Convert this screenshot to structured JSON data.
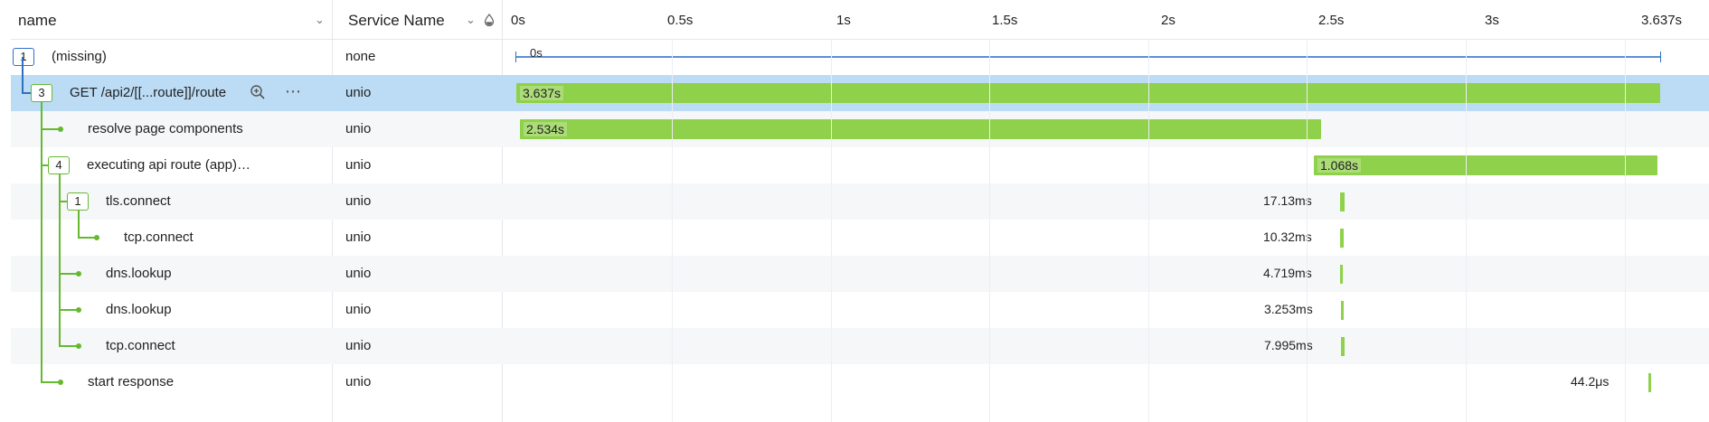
{
  "header": {
    "name_col": "name",
    "service_col": "Service Name",
    "ticks": [
      "0s",
      "0.5s",
      "1s",
      "1.5s",
      "2s",
      "2.5s",
      "3s",
      "3.637s"
    ]
  },
  "rows": [
    {
      "badge": "1",
      "name": "(missing)",
      "service": "none",
      "bar_label": "0s"
    },
    {
      "badge": "3",
      "name": "GET /api2/[[...route]]/route",
      "service": "unio",
      "bar_label": "3.637s"
    },
    {
      "name": "resolve page components",
      "service": "unio",
      "bar_label": "2.534s"
    },
    {
      "badge": "4",
      "name": "executing api route (app)…",
      "service": "unio",
      "bar_label": "1.068s"
    },
    {
      "badge": "1",
      "name": "tls.connect",
      "service": "unio",
      "bar_label": "17.13ms"
    },
    {
      "name": "tcp.connect",
      "service": "unio",
      "bar_label": "10.32ms"
    },
    {
      "name": "dns.lookup",
      "service": "unio",
      "bar_label": "4.719ms"
    },
    {
      "name": "dns.lookup",
      "service": "unio",
      "bar_label": "3.253ms"
    },
    {
      "name": "tcp.connect",
      "service": "unio",
      "bar_label": "7.995ms"
    },
    {
      "name": "start response",
      "service": "unio",
      "bar_label": "44.2μs"
    }
  ],
  "icons": [
    "chevron-down-icon",
    "water-drop-icon",
    "zoom-in-icon",
    "more-horizontal-icon"
  ],
  "colors": {
    "bar": "#8fd14a",
    "selected_row": "#bcdcf5",
    "tree_line": "#64b92f",
    "missing_accent": "#2f6fc4"
  }
}
